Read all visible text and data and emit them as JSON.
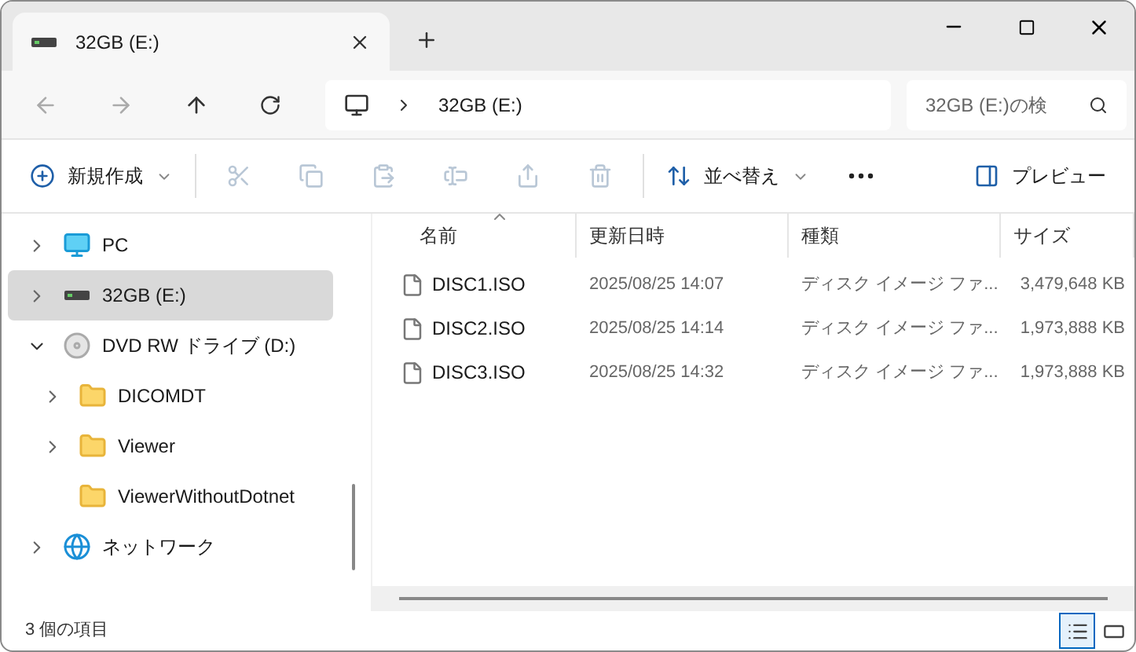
{
  "tab": {
    "title": "32GB (E:)"
  },
  "address": {
    "crumb": "32GB (E:)"
  },
  "search": {
    "placeholder": "32GB (E:)の検"
  },
  "toolbar": [
    {
      "kind": "new",
      "label": "新規作成",
      "disabled": false
    },
    {
      "kind": "cut",
      "disabled": true
    },
    {
      "kind": "copy",
      "disabled": true
    },
    {
      "kind": "paste",
      "disabled": true
    },
    {
      "kind": "rename",
      "disabled": true
    },
    {
      "kind": "share",
      "disabled": true
    },
    {
      "kind": "delete",
      "disabled": true
    },
    {
      "kind": "sort",
      "label": "並べ替え",
      "disabled": false
    },
    {
      "kind": "more",
      "disabled": false
    },
    {
      "kind": "preview",
      "label": "プレビュー",
      "disabled": false
    }
  ],
  "sidebar": {
    "items": [
      {
        "kind": "pc",
        "label": "PC",
        "expandable": true,
        "expanded": false,
        "selected": false
      },
      {
        "kind": "drive",
        "label": "32GB (E:)",
        "expandable": true,
        "expanded": false,
        "selected": true
      },
      {
        "kind": "dvd",
        "label": "DVD RW ドライブ (D:)",
        "expandable": true,
        "expanded": true,
        "selected": false,
        "children": [
          {
            "kind": "folder",
            "label": "DICOMDT",
            "expandable": true,
            "expanded": false,
            "selected": false
          },
          {
            "kind": "folder",
            "label": "Viewer",
            "expandable": true,
            "expanded": false,
            "selected": false
          },
          {
            "kind": "folder",
            "label": "ViewerWithoutDotnet",
            "expandable": false,
            "expanded": false,
            "selected": false
          }
        ]
      },
      {
        "kind": "network",
        "label": "ネットワーク",
        "expandable": true,
        "expanded": false,
        "selected": false
      }
    ]
  },
  "table": {
    "columns": [
      "名前",
      "更新日時",
      "種類",
      "サイズ"
    ],
    "rows": [
      [
        "DISC1.ISO",
        "2025/08/25 14:07",
        "ディスク イメージ ファ...",
        "3,479,648 KB"
      ],
      [
        "DISC2.ISO",
        "2025/08/25 14:14",
        "ディスク イメージ ファ...",
        "1,973,888 KB"
      ],
      [
        "DISC3.ISO",
        "2025/08/25 14:32",
        "ディスク イメージ ファ...",
        "1,973,888 KB"
      ]
    ]
  },
  "status_bar": {
    "count": "3 個の項目"
  },
  "views": [
    {
      "kind": "details",
      "selected": true
    },
    {
      "kind": "tiles",
      "selected": false
    }
  ]
}
